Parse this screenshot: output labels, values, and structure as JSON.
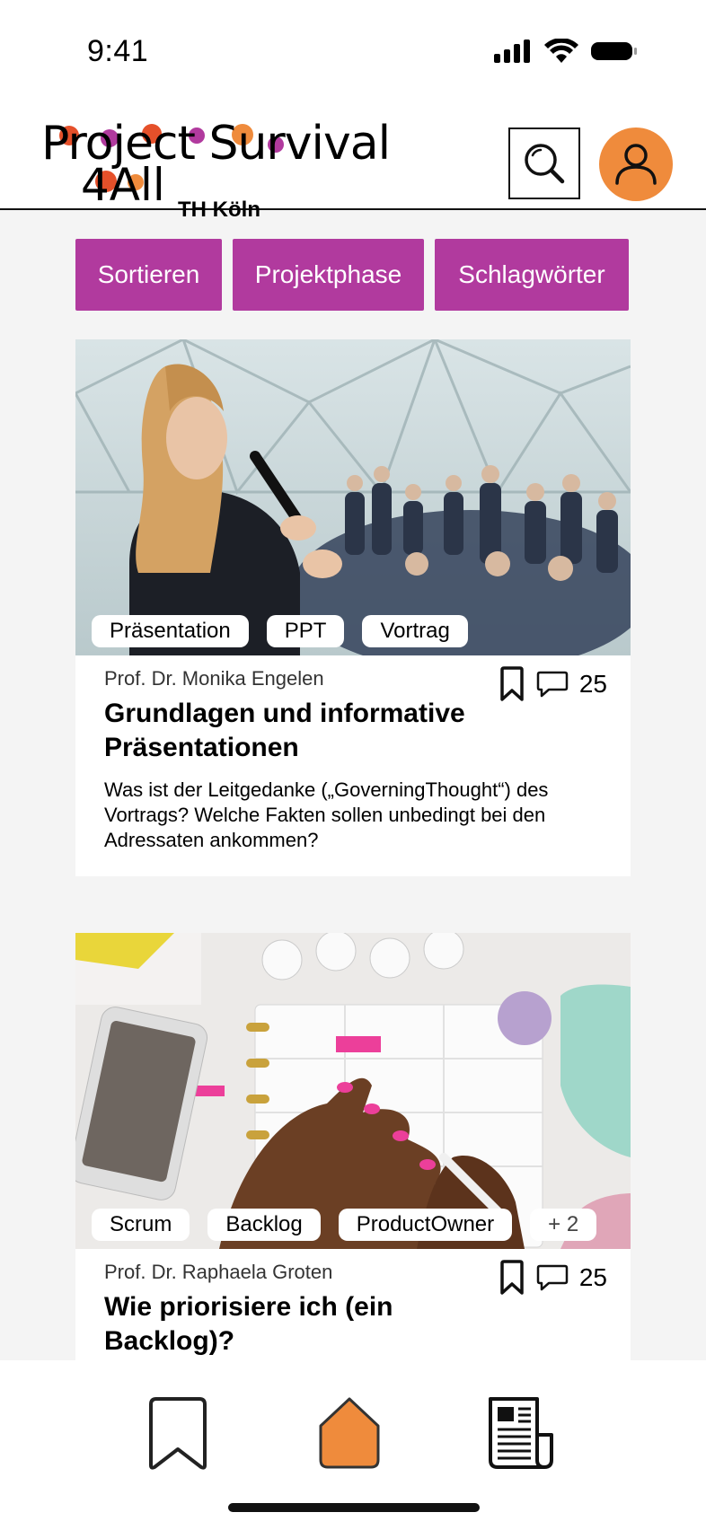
{
  "status_bar": {
    "time": "9:41"
  },
  "header": {
    "logo": {
      "line1": "Project Survival",
      "line2": "4All",
      "subtitle": "TH Köln"
    }
  },
  "filters": [
    "Sortieren",
    "Projektphase",
    "Schlagwörter"
  ],
  "cards": [
    {
      "tags": [
        "Präsentation",
        "PPT",
        "Vortrag"
      ],
      "author": "Prof. Dr. Monika Engelen",
      "comment_count": "25",
      "title": "Grundlagen und informative Präsentationen",
      "description": "Was ist der Leitgedanke („GoverningThought“) des Vortrags? Welche Fakten  sollen unbedingt bei den Adressaten ankommen?"
    },
    {
      "tags": [
        "Scrum",
        "Backlog",
        "ProductOwner",
        "+ 2"
      ],
      "author": "Prof. Dr. Raphaela Groten",
      "comment_count": "25",
      "title": "Wie priorisiere ich (ein Backlog)?",
      "description": ""
    }
  ],
  "colors": {
    "accent": "#b13a9e",
    "brand_orange": "#ef8b3c"
  },
  "icons": {
    "search": "search-icon",
    "profile": "user-icon",
    "bookmark": "bookmark-icon",
    "comment": "comment-icon",
    "home": "home-icon",
    "news": "newspaper-icon"
  }
}
